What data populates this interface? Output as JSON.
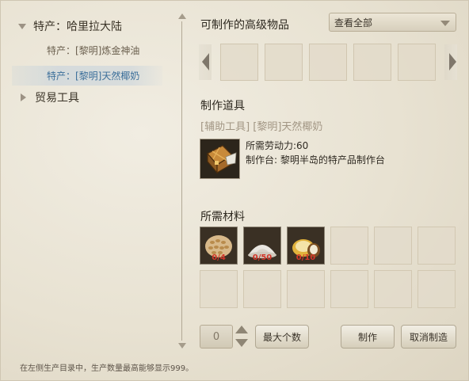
{
  "tree": {
    "category_1": {
      "label": "特产：哈里拉大陆",
      "expanded": true
    },
    "items": [
      {
        "label": "特产：[黎明]炼金神油",
        "selected": false
      },
      {
        "label": "特产：[黎明]天然椰奶",
        "selected": true
      }
    ],
    "category_2": {
      "label": "贸易工具",
      "expanded": false
    }
  },
  "footer_note": "在左侧生产目录中，生产数量最高能够显示999。",
  "craftable": {
    "heading": "可制作的高级物品",
    "filter": {
      "selected": "查看全部"
    }
  },
  "tool": {
    "heading": "制作道具",
    "name": "[辅助工具] [黎明]天然椰奶",
    "labor": "所需劳动力:60",
    "workbench": "制作台: 黎明半岛的特产品制作台"
  },
  "materials": {
    "heading": "所需材料",
    "items": [
      {
        "icon": "wheat-grain-icon",
        "count": "0/4"
      },
      {
        "icon": "flour-pile-icon",
        "count": "0/50"
      },
      {
        "icon": "coconut-icon",
        "count": "0/10"
      }
    ]
  },
  "controls": {
    "quantity": "0",
    "max_button": "最大个数",
    "craft_button": "制作",
    "cancel_button": "取消制造"
  },
  "colors": {
    "selected_item": "#3c6f9a",
    "material_count": "#d2362a",
    "tool_name": "#a29684"
  }
}
